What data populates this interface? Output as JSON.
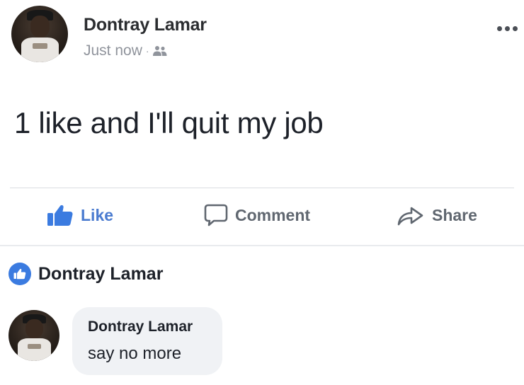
{
  "post": {
    "author": "Dontray Lamar",
    "timestamp": "Just now",
    "separator": "·",
    "audience_icon": "friends-icon",
    "text": "1 like and I'll quit my job"
  },
  "actions": {
    "like_label": "Like",
    "comment_label": "Comment",
    "share_label": "Share"
  },
  "reactions": {
    "liked_by": "Dontray Lamar"
  },
  "comment": {
    "author": "Dontray Lamar",
    "text": "say no more"
  },
  "colors": {
    "like_blue": "#4a7bd0",
    "badge_blue": "#3b7be0",
    "bubble_bg": "#f0f2f5",
    "muted_text": "#90949c"
  }
}
